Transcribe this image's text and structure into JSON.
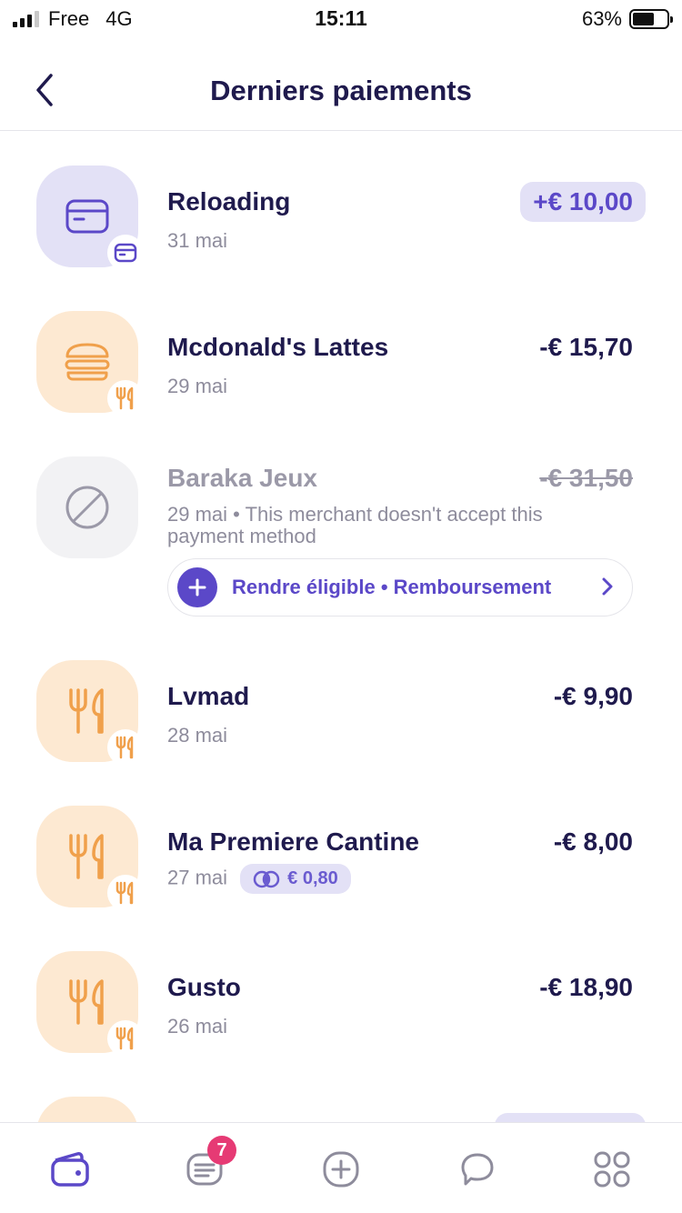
{
  "status_bar": {
    "carrier": "Free",
    "network": "4G",
    "time": "15:11",
    "battery": "63%",
    "battery_level": 0.63
  },
  "header": {
    "title": "Derniers paiements"
  },
  "transactions": [
    {
      "merchant": "Reloading",
      "date": "31 mai",
      "amount": "+€ 10,00",
      "icon": "card-icon",
      "badge": "card-icon",
      "color": "#e3e1f6"
    },
    {
      "merchant": "Mcdonald's Lattes",
      "date": "29 mai",
      "amount": "-€ 15,70",
      "icon": "burger-icon",
      "badge": "fork-knife-icon",
      "color": "#fde9d2"
    },
    {
      "merchant": "Baraka Jeux",
      "date": "29 mai",
      "note": "• This merchant doesn't accept this payment method",
      "amount": "-€ 31,50",
      "icon": "blocked-icon",
      "action_label": "Rendre éligible • Remboursement"
    },
    {
      "merchant": "Lvmad",
      "date": "28 mai",
      "amount": "-€ 9,90",
      "icon": "fork-knife-icon",
      "badge": "fork-knife-icon"
    },
    {
      "merchant": "Ma Premiere Cantine",
      "date": "27 mai",
      "amount": "-€ 8,00",
      "cashback": "€ 0,80",
      "icon": "fork-knife-icon",
      "badge": "fork-knife-icon"
    },
    {
      "merchant": "Gusto",
      "date": "26 mai",
      "amount": "-€ 18,90",
      "icon": "fork-knife-icon",
      "badge": "fork-knife-icon"
    }
  ],
  "tabbar": {
    "items": [
      "wallet-icon",
      "receipt-icon",
      "plus-circle-icon",
      "chat-icon",
      "grid-icon"
    ],
    "notification_count": "7"
  },
  "colors": {
    "accent": "#5b48c8",
    "text": "#1f1a4d",
    "muted": "#8e8c9c",
    "orange": "#f0a04b",
    "notification": "#e63a74"
  }
}
